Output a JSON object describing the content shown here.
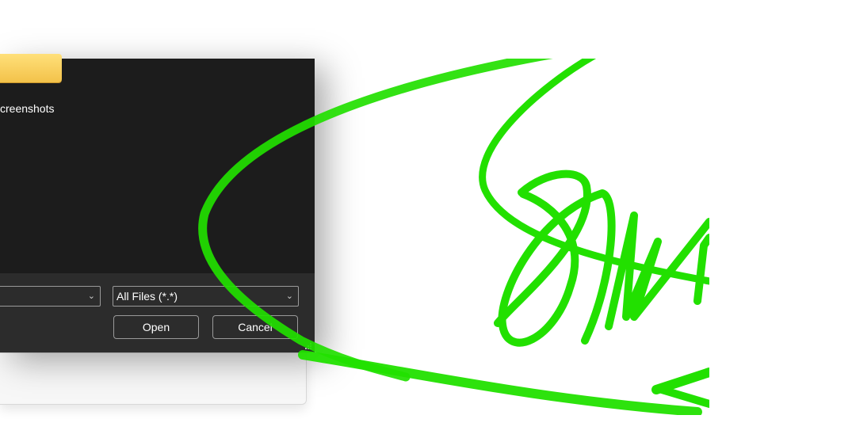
{
  "dialog": {
    "folder_label": "creenshots",
    "file_type_select": {
      "value": "All Files (*.*)"
    },
    "file_name_select": {
      "value": ""
    },
    "open_label": "Open",
    "cancel_label": "Cancel"
  },
  "icons": {
    "chevron": "chevron-down-icon",
    "resize": "resize-grip-icon",
    "folder": "folder-icon"
  },
  "colors": {
    "stroke": "#22e000",
    "dialog_bg": "#1c1c1c",
    "footer_bg": "#2c2c2c"
  }
}
